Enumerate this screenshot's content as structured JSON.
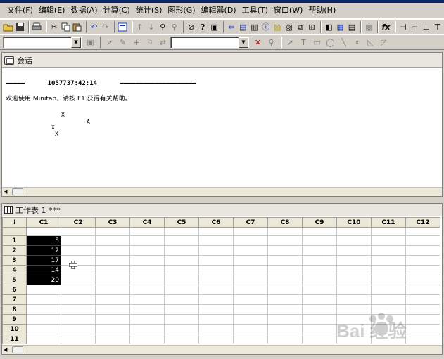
{
  "menu": [
    "文件(F)",
    "编辑(E)",
    "数据(A)",
    "计算(C)",
    "统计(S)",
    "图形(G)",
    "编辑器(D)",
    "工具(T)",
    "窗口(W)",
    "帮助(H)"
  ],
  "session": {
    "title": "会话",
    "line1": "—————      1057737:42:14      ————————————————————",
    "line2": "欢迎使用 Minitab，请按 F1 获得有关帮助。",
    "points": [
      "X",
      "A",
      "X",
      "X"
    ]
  },
  "worksheet": {
    "title": "工作表 1 ***",
    "corner": "↓",
    "columns": [
      "C1",
      "C2",
      "C3",
      "C4",
      "C5",
      "C6",
      "C7",
      "C8",
      "C9",
      "C10",
      "C11",
      "C12"
    ],
    "rows": [
      "1",
      "2",
      "3",
      "4",
      "5",
      "6",
      "7",
      "8",
      "9",
      "10",
      "11"
    ],
    "c1_values": [
      "5",
      "12",
      "17",
      "14",
      "20"
    ]
  },
  "watermark": "Bai 经验"
}
